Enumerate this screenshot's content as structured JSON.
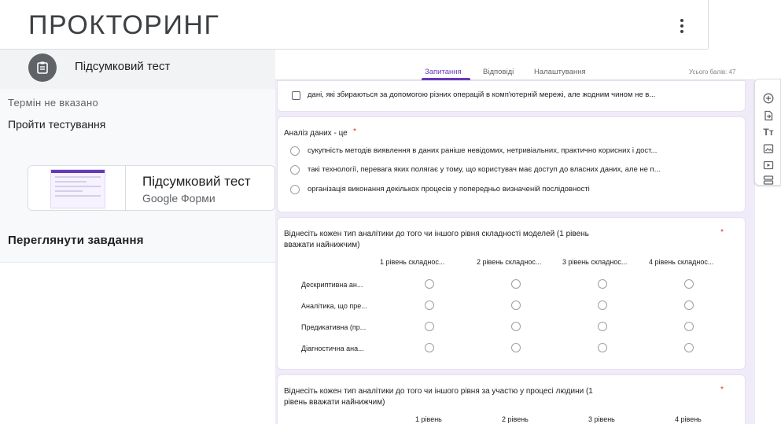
{
  "app": {
    "title": "ПРОКТОРИНГ"
  },
  "assignment": {
    "title": "Підсумковий тест",
    "due": "Термін не вказано",
    "take_test": "Пройти тестування",
    "attachment": {
      "name": "Підсумковий тест",
      "type": "Google Форми"
    },
    "view_work": "Переглянути завдання"
  },
  "forms": {
    "tabs": [
      "Запитання",
      "Відповіді",
      "Налаштування"
    ],
    "active_tab": "Запитання",
    "total_points": "Усього балів: 47",
    "accent_color": "#673ab7",
    "background_color": "#f0ebf8",
    "prev_question_option": "дані, які збираються за допомогою різних операцій в комп'ютерній мережі, але жодним чином не в...",
    "q1": {
      "title": "Аналіз даних - це",
      "required": "*",
      "options": [
        "сукупність методів виявлення в даних раніше невідомих, нетривіальних, практично корисних і дост...",
        "такі технології, перевага яких полягає у тому, що користувач має доступ до власних даних, але не п...",
        "організація виконання декількох процесів у попередньо визначеній послідовності"
      ]
    },
    "q2": {
      "title_line1": "Віднесіть кожен тип аналітики до того чи іншого рівня складності моделей (1 рівень",
      "title_line2": "вважати найнижчим)",
      "required": "*",
      "columns": [
        "1 рівень складнос...",
        "2 рівень складнос...",
        "3 рівень складнос...",
        "4 рівень складнос..."
      ],
      "rows": [
        "Дескриптивна ан...",
        "Аналітика, що пре...",
        "Предикативна (пр...",
        "Діагностична ана..."
      ]
    },
    "q3": {
      "title_line1": "Віднесіть кожен тип аналітики до того чи іншого рівня за участю у процесі людини (1",
      "title_line2": "рівень вважати найнижчим)",
      "required": "*",
      "columns": [
        "1 рівень",
        "2 рівень",
        "3 рівень",
        "4 рівень"
      ]
    }
  },
  "toolbar": {
    "icons": [
      "add-question-icon",
      "import-questions-icon",
      "add-title-icon",
      "add-image-icon",
      "add-video-icon",
      "add-section-icon"
    ],
    "title_glyph": "Tт"
  }
}
